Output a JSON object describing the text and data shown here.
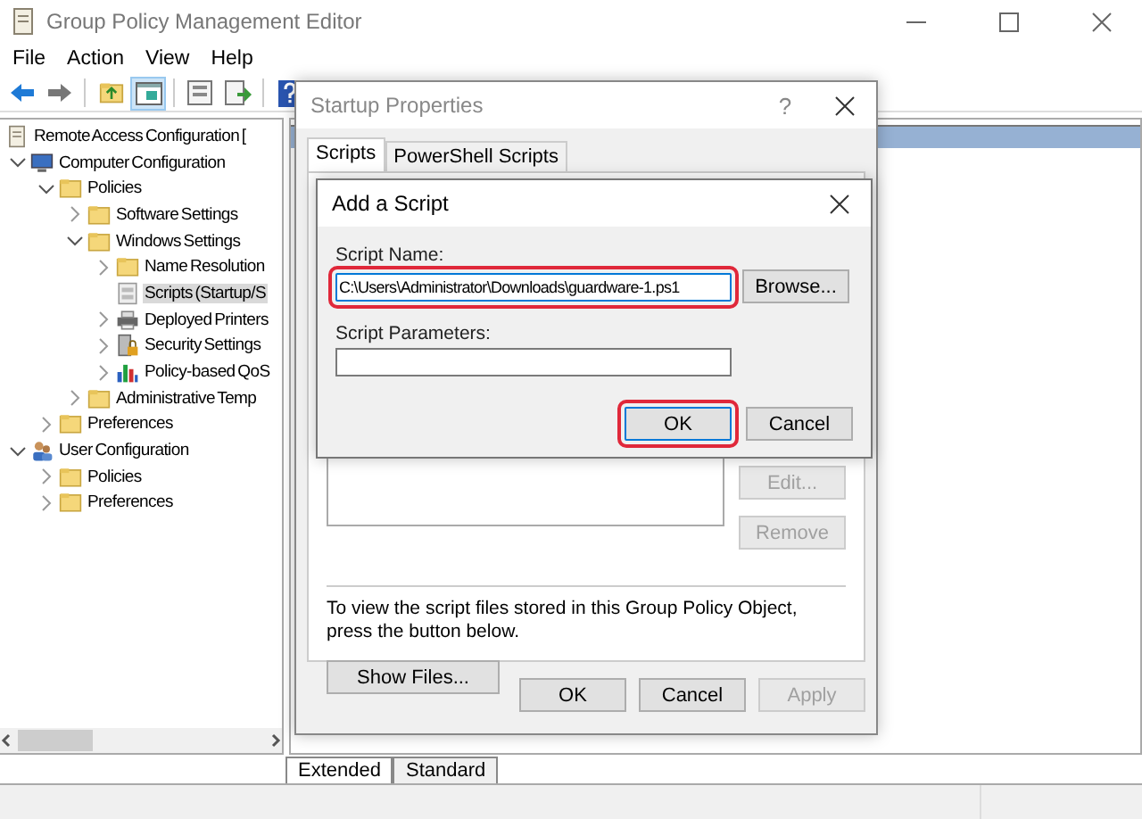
{
  "window": {
    "title": "Group Policy Management Editor"
  },
  "menu": [
    "File",
    "Action",
    "View",
    "Help"
  ],
  "tree": [
    {
      "label": "Remote Access Configuration [",
      "kind": "document",
      "selected": false,
      "children": [
        {
          "label": "Computer Configuration",
          "kind": "computer",
          "expanded": true,
          "selected": false,
          "children": [
            {
              "label": "Policies",
              "kind": "folder",
              "expanded": true,
              "selected": false,
              "children": [
                {
                  "label": "Software Settings",
                  "kind": "folder",
                  "expanded": false,
                  "selected": false
                },
                {
                  "label": "Windows Settings",
                  "kind": "folder",
                  "expanded": true,
                  "selected": false,
                  "children": [
                    {
                      "label": "Name Resolution",
                      "kind": "folder",
                      "expanded": false,
                      "selected": false
                    },
                    {
                      "label": "Scripts (Startup/S",
                      "kind": "scripts",
                      "selected": true
                    },
                    {
                      "label": "Deployed Printers",
                      "kind": "printer",
                      "expanded": false,
                      "selected": false
                    },
                    {
                      "label": "Security Settings",
                      "kind": "security",
                      "expanded": false,
                      "selected": false
                    },
                    {
                      "label": "Policy-based QoS",
                      "kind": "chart",
                      "expanded": false,
                      "selected": false
                    }
                  ]
                },
                {
                  "label": "Administrative Temp",
                  "kind": "folder",
                  "expanded": false,
                  "selected": false
                }
              ]
            },
            {
              "label": "Preferences",
              "kind": "folder",
              "expanded": false,
              "selected": false
            }
          ]
        },
        {
          "label": "User Configuration",
          "kind": "user",
          "expanded": true,
          "selected": false,
          "children": [
            {
              "label": "Policies",
              "kind": "folder",
              "expanded": false,
              "selected": false
            },
            {
              "label": "Preferences",
              "kind": "folder",
              "expanded": false,
              "selected": false
            }
          ]
        }
      ]
    }
  ],
  "view_tabs": [
    {
      "label": "Extended",
      "selected": true
    },
    {
      "label": "Standard",
      "selected": false
    }
  ],
  "startup_dialog": {
    "title": "Startup Properties",
    "help": "?",
    "tabs": [
      {
        "label": "Scripts",
        "selected": true
      },
      {
        "label": "PowerShell Scripts",
        "selected": false
      }
    ],
    "side_buttons": [
      {
        "label": "Edit...",
        "disabled": true
      },
      {
        "label": "Remove",
        "disabled": true
      }
    ],
    "note": "To view the script files stored in this Group Policy Object, press the button below.",
    "show_files": "Show Files...",
    "buttons": [
      {
        "label": "OK",
        "disabled": false
      },
      {
        "label": "Cancel",
        "disabled": false
      },
      {
        "label": "Apply",
        "disabled": true
      }
    ]
  },
  "add_dialog": {
    "title": "Add a Script",
    "script_name": {
      "label": "Script Name:",
      "value": "C:\\Users\\Administrator\\Downloads\\guardware-1.ps1",
      "highlighted": true
    },
    "browse": "Browse...",
    "script_parameters": {
      "label": "Script Parameters:"
    },
    "buttons": [
      {
        "label": "OK",
        "highlighted": true
      },
      {
        "label": "Cancel",
        "highlighted": false
      }
    ]
  }
}
